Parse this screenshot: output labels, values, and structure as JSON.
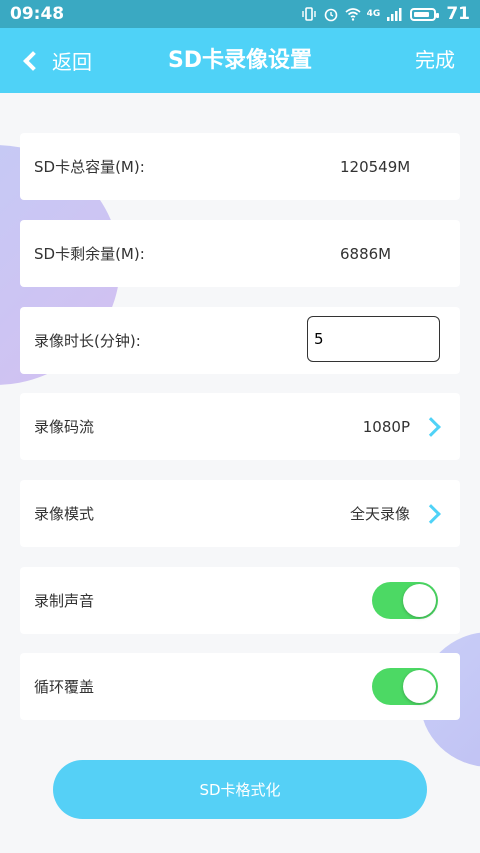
{
  "status_bar": {
    "time": "09:48",
    "network": "4G",
    "battery": "71"
  },
  "nav": {
    "back_label": "返回",
    "title": "SD卡录像设置",
    "done_label": "完成"
  },
  "rows": {
    "total_capacity": {
      "label": "SD卡总容量(M):",
      "value": "120549M"
    },
    "free_capacity": {
      "label": "SD卡剩余量(M):",
      "value": "6886M"
    },
    "duration": {
      "label": "录像时长(分钟):",
      "value": "5"
    },
    "bitrate": {
      "label": "录像码流",
      "value": "1080P"
    },
    "mode": {
      "label": "录像模式",
      "value": "全天录像"
    },
    "audio": {
      "label": "录制声音",
      "enabled": true
    },
    "loop": {
      "label": "循环覆盖",
      "enabled": true
    }
  },
  "format_button": "SD卡格式化",
  "colors": {
    "accent": "#4fd2f7",
    "status_bar": "#3aa9c2",
    "toggle_on": "#4cd964"
  }
}
